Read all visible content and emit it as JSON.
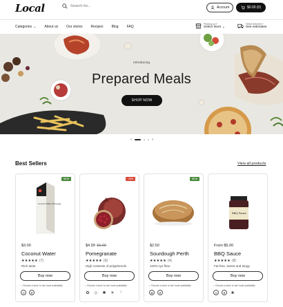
{
  "brand": {
    "logo_text": "Local"
  },
  "header": {
    "search_placeholder": "Search for...",
    "account_label": "Account",
    "cart_label": "$0.00 (0)"
  },
  "nav": {
    "items": [
      "Categories",
      "About us",
      "Our stores",
      "Recipes",
      "Blog",
      "FAQ"
    ],
    "pickup": {
      "small": "Picking up?",
      "big": "Select store"
    },
    "delivery": {
      "small": "Need delivery?",
      "big": "See estimates"
    }
  },
  "hero": {
    "intro": "Introducing",
    "title": "Prepared Meals",
    "cta": "SHOP NOW",
    "carousel": {
      "prev": "‹",
      "next": "›",
      "active_index": 0,
      "count": 3
    }
  },
  "best_sellers": {
    "title": "Best Sellers",
    "view_all": "View all products",
    "buy_label": "Buy now",
    "availability_text": "Choose a store to see local availability",
    "products": [
      {
        "badge": "NEW",
        "badge_color": "#4a8a3c",
        "price": "$3.00",
        "old_price": "",
        "name": "Coconut Water",
        "stars": "★★★★★",
        "reviews": "(7)",
        "desc": "Rich taste",
        "package_text": "Coconut Water Beverage"
      },
      {
        "badge": "-15%",
        "badge_color": "#d94a3a",
        "price": "$4.99",
        "old_price": "$6.99",
        "name": "Pomegranate",
        "stars": "★★★★★",
        "reviews": "(9)",
        "desc": "High contents of polyphenols"
      },
      {
        "badge": "NEW",
        "badge_color": "#4a8a3c",
        "price": "$2.50",
        "old_price": "",
        "name": "Sourdough Perth",
        "stars": "★★★★★",
        "reviews": "(4)",
        "desc": "100% rye flour"
      },
      {
        "badge": "",
        "badge_color": "",
        "price": "From $5.00",
        "old_price": "",
        "name": "BBQ Sauce",
        "stars": "★★★★★",
        "reviews": "(8)",
        "desc": "Fat free, sweet and tangy",
        "jar_label": "BBQ Sauce"
      }
    ]
  },
  "colors": {
    "accent": "#111111",
    "hero_bg": "#e9e7e1",
    "new_badge": "#4a8a3c",
    "sale_badge": "#d94a3a"
  }
}
